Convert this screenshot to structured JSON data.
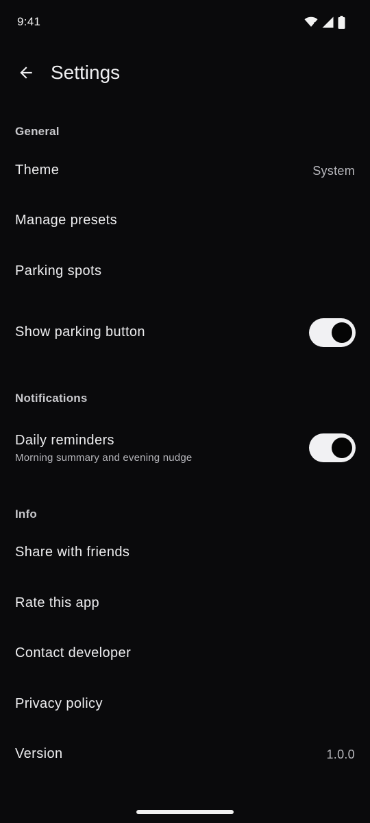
{
  "status_bar": {
    "time": "9:41",
    "icons": [
      "wifi-icon",
      "cellular-signal-icon",
      "battery-icon"
    ]
  },
  "app_bar": {
    "back_icon": "arrow-left-icon",
    "title": "Settings"
  },
  "sections": {
    "general": {
      "header": "General",
      "theme": {
        "label": "Theme",
        "value": "System"
      },
      "manage_presets": {
        "label": "Manage presets"
      },
      "parking_spots": {
        "label": "Parking spots"
      },
      "show_parking_button": {
        "label": "Show parking button",
        "enabled": true
      }
    },
    "notifications": {
      "header": "Notifications",
      "daily_reminders": {
        "label": "Daily reminders",
        "subtitle": "Morning summary and evening nudge",
        "enabled": true
      }
    },
    "info": {
      "header": "Info",
      "share": {
        "label": "Share with friends"
      },
      "rate": {
        "label": "Rate this app"
      },
      "contact": {
        "label": "Contact developer"
      },
      "privacy": {
        "label": "Privacy policy"
      },
      "version": {
        "label": "Version",
        "value": "1.0.0"
      }
    }
  },
  "colors": {
    "background": "#0a0a0c",
    "toggle_track_on": "#f1f1f3",
    "toggle_knob_on": "#050505"
  }
}
